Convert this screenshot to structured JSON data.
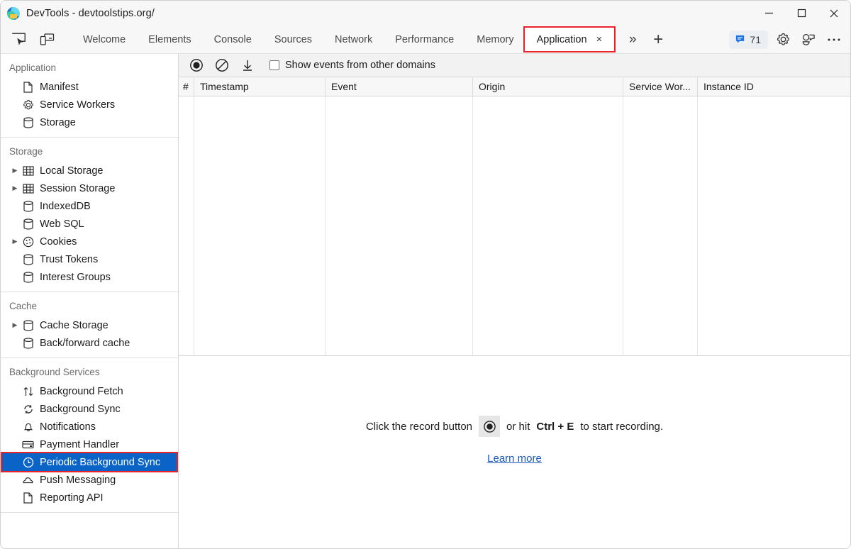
{
  "window": {
    "title": "DevTools - devtoolstips.org/",
    "app_icon": "edge-devtools-icon",
    "controls": {
      "minimize": "minimize-icon",
      "maximize": "maximize-icon",
      "close": "close-icon"
    }
  },
  "toolbar_left": {
    "inspect_label": "inspect-element-icon",
    "device_label": "device-toolbar-icon"
  },
  "tabs": [
    {
      "label": "Welcome",
      "active": false
    },
    {
      "label": "Elements",
      "active": false
    },
    {
      "label": "Console",
      "active": false
    },
    {
      "label": "Sources",
      "active": false
    },
    {
      "label": "Network",
      "active": false
    },
    {
      "label": "Performance",
      "active": false
    },
    {
      "label": "Memory",
      "active": false
    },
    {
      "label": "Application",
      "active": true,
      "closeable": true,
      "close_glyph": "×",
      "highlighted": true
    }
  ],
  "tab_extra": {
    "more_tabs": "»",
    "add_tab": "+"
  },
  "right_tools": {
    "issues_count": "71",
    "issues_icon": "issues-message-icon",
    "settings_icon": "gear-icon",
    "customize_icon": "customize-icon",
    "more_icon": "more-options-icon"
  },
  "sidebar": {
    "groups": [
      {
        "title": "Application",
        "items": [
          {
            "label": "Manifest",
            "icon": "document-icon",
            "twisty": false
          },
          {
            "label": "Service Workers",
            "icon": "gear-icon",
            "twisty": false
          },
          {
            "label": "Storage",
            "icon": "database-icon",
            "twisty": false
          }
        ]
      },
      {
        "title": "Storage",
        "items": [
          {
            "label": "Local Storage",
            "icon": "table-icon",
            "twisty": true
          },
          {
            "label": "Session Storage",
            "icon": "table-icon",
            "twisty": true
          },
          {
            "label": "IndexedDB",
            "icon": "database-icon",
            "twisty": false
          },
          {
            "label": "Web SQL",
            "icon": "database-icon",
            "twisty": false
          },
          {
            "label": "Cookies",
            "icon": "cookie-icon",
            "twisty": true
          },
          {
            "label": "Trust Tokens",
            "icon": "database-icon",
            "twisty": false
          },
          {
            "label": "Interest Groups",
            "icon": "database-icon",
            "twisty": false
          }
        ]
      },
      {
        "title": "Cache",
        "items": [
          {
            "label": "Cache Storage",
            "icon": "database-icon",
            "twisty": true
          },
          {
            "label": "Back/forward cache",
            "icon": "database-icon",
            "twisty": false
          }
        ]
      },
      {
        "title": "Background Services",
        "items": [
          {
            "label": "Background Fetch",
            "icon": "arrows-updown-icon",
            "twisty": false
          },
          {
            "label": "Background Sync",
            "icon": "sync-icon",
            "twisty": false
          },
          {
            "label": "Notifications",
            "icon": "bell-icon",
            "twisty": false
          },
          {
            "label": "Payment Handler",
            "icon": "card-icon",
            "twisty": false
          },
          {
            "label": "Periodic Background Sync",
            "icon": "clock-icon",
            "twisty": false,
            "selected": true,
            "highlighted": true
          },
          {
            "label": "Push Messaging",
            "icon": "cloud-icon",
            "twisty": false
          },
          {
            "label": "Reporting API",
            "icon": "document-icon",
            "twisty": false
          }
        ]
      }
    ]
  },
  "panel": {
    "toolbar": {
      "record_icon": "record-icon",
      "clear_icon": "clear-ban-icon",
      "export_icon": "download-icon",
      "checkbox_label": "Show events from other domains",
      "checkbox_checked": false
    },
    "table": {
      "columns": [
        "#",
        "Timestamp",
        "Event",
        "Origin",
        "Service Wor...",
        "Instance ID"
      ],
      "rows": []
    },
    "empty_state": {
      "prefix": "Click the record button",
      "record_icon": "record-icon",
      "middle": "or hit",
      "shortcut": "Ctrl + E",
      "suffix": "to start recording.",
      "learn_more": "Learn more"
    }
  },
  "colors": {
    "selection_blue": "#0a64c8",
    "highlight_red": "#e8232a",
    "link_blue": "#1a56b8",
    "issues_blue": "#1a73e8"
  }
}
